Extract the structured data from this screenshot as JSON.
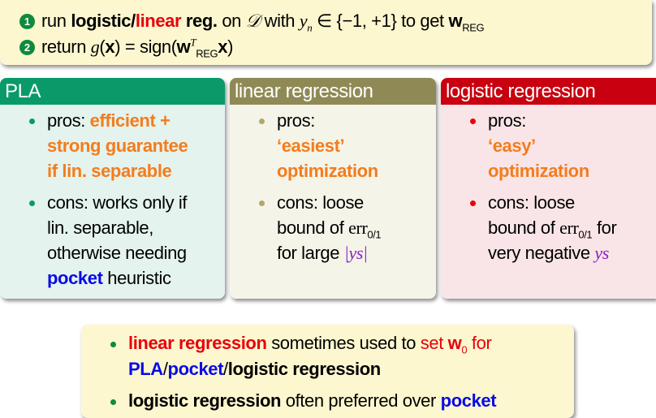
{
  "steps": [
    {
      "number": "1",
      "run": "run",
      "logistic": "logistic/",
      "linear": "linear",
      "reg": " reg.",
      "on": " on ",
      "D": "𝒟",
      "with": " with ",
      "yn": "y",
      "n": "n",
      "set": " ∈ {−1, +1} to get ",
      "w": "w",
      "REG": "REG"
    },
    {
      "number": "2",
      "return": "return ",
      "g": "g",
      "x_open": "(",
      "x": "x",
      "eq": ") = sign(",
      "w": "w",
      "T": "T",
      "REG": "REG",
      "close": ")"
    }
  ],
  "columns": [
    {
      "title": "PLA",
      "color": "#0a9a6a",
      "pros_label": "pros: ",
      "pros": [
        "efficient +",
        "strong guarantee",
        "if lin. separable"
      ],
      "cons": [
        "cons: works only if",
        "lin. separable,",
        "otherwise needing"
      ],
      "pocket": "pocket",
      "heuristic": " heuristic"
    },
    {
      "title": "linear regression",
      "color": "#8f8a55",
      "pros_label": "pros:",
      "pros": [
        "‘easiest’",
        "optimization"
      ],
      "cons": [
        "cons: loose",
        "bound of ",
        "for large "
      ],
      "err": "err",
      "err_sub": "0/1",
      "ys": "|ys|"
    },
    {
      "title": "logistic regression",
      "color": "#c8000f",
      "pros_label": "pros:",
      "pros": [
        "‘easy’",
        "optimization"
      ],
      "cons": [
        "cons: loose",
        "bound of ",
        "very negative "
      ],
      "err": "err",
      "err_sub": "0/1",
      "for": " for",
      "ys": "ys"
    }
  ],
  "bottom": {
    "item1": {
      "linreg": "linear regression",
      "mid": " sometimes used to ",
      "set": "set ",
      "w": "w",
      "w_sub": "0",
      "for": " for",
      "pla": "PLA",
      "slash1": "/",
      "pocket": "pocket",
      "slash2": "/",
      "logreg": "logistic regression"
    },
    "item2": {
      "logreg": "logistic regression",
      "mid": " often preferred over ",
      "pocket": "pocket"
    }
  }
}
